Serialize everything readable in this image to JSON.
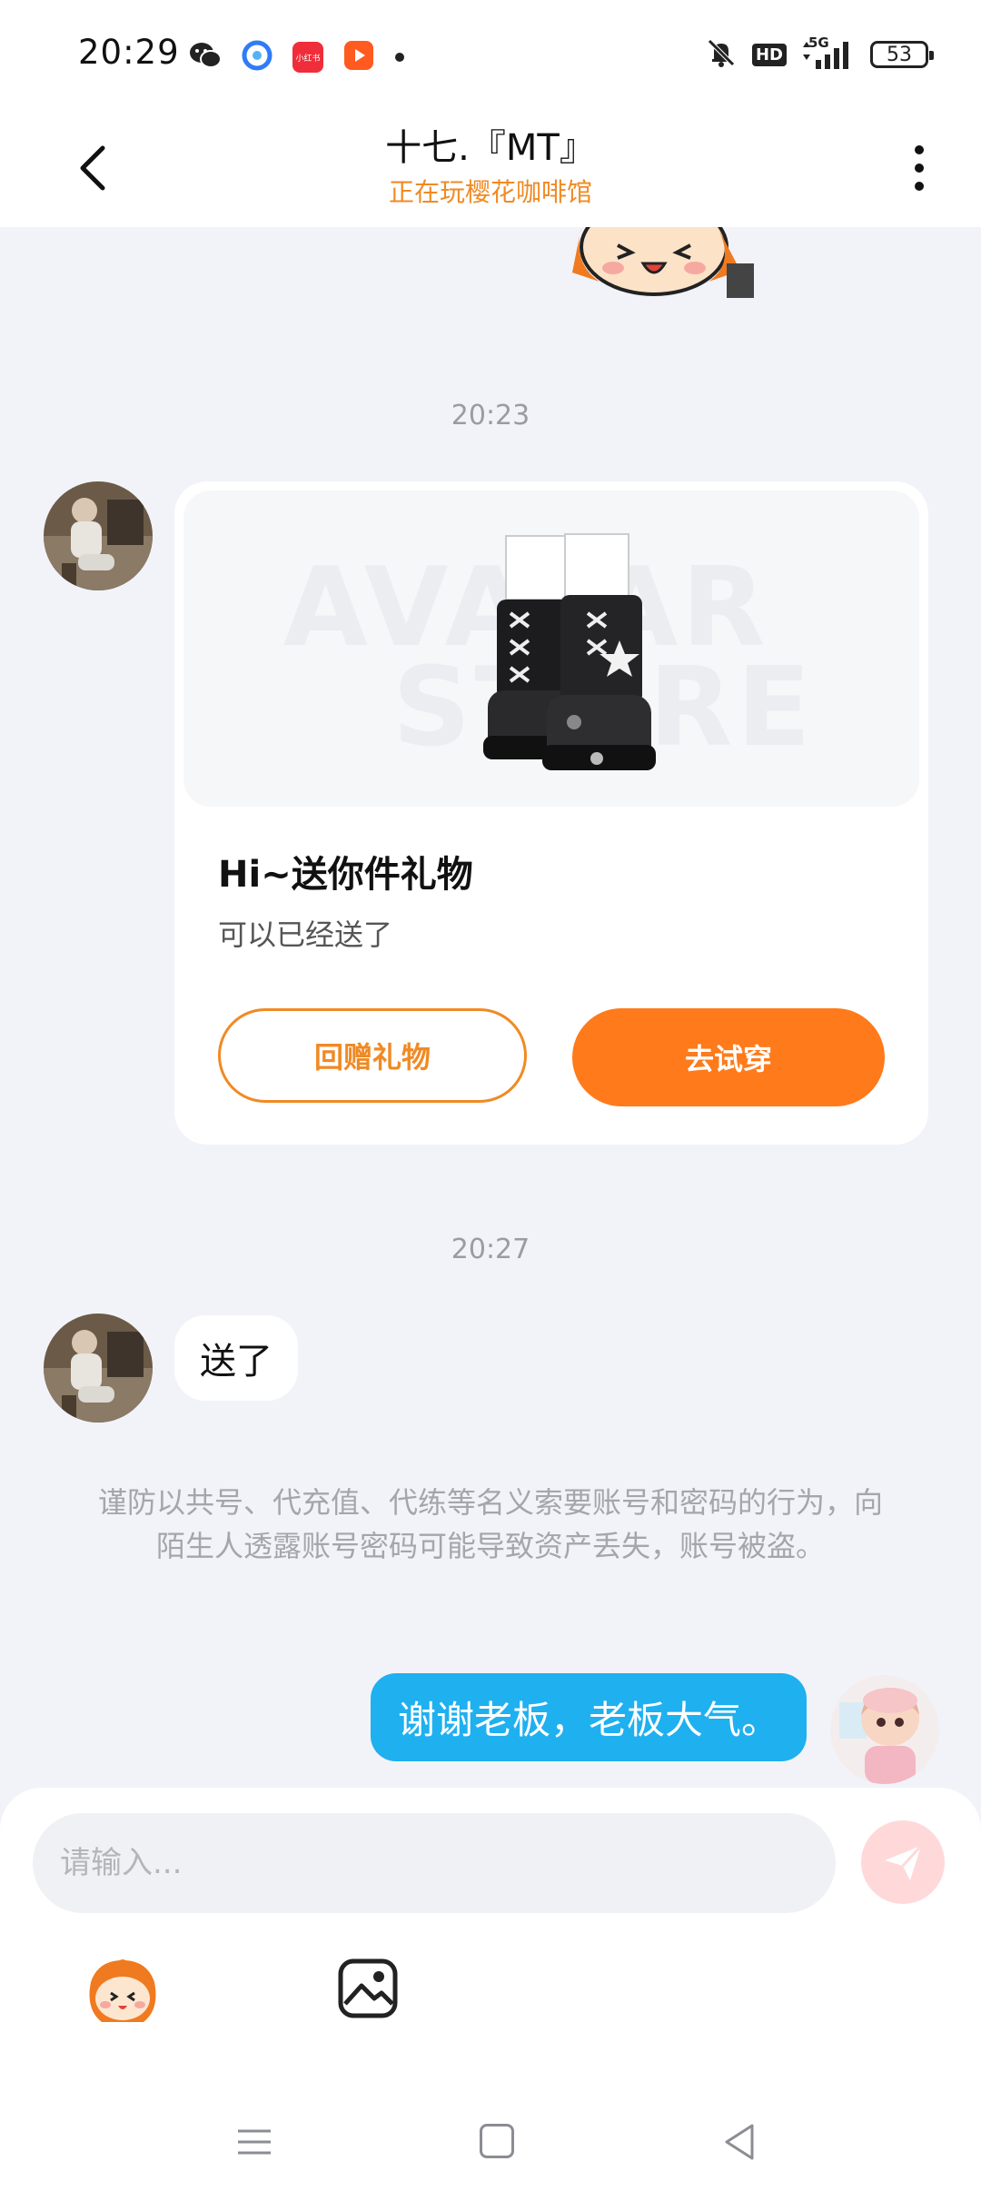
{
  "status_bar": {
    "time": "20:29",
    "network": "5G",
    "hd_label": "HD",
    "battery": "53",
    "notification_icons": [
      "wechat-icon",
      "browser-icon",
      "xiaohongshu-icon",
      "video-icon",
      "dot-icon"
    ],
    "xiaohongshu_label": "小红书"
  },
  "header": {
    "title": "十七.『MT』",
    "subtitle": "正在玩樱花咖啡馆"
  },
  "chat": {
    "messages": [
      {
        "type": "timestamp",
        "text": "20:23"
      },
      {
        "type": "gift",
        "watermark_line1": "AVATAR",
        "watermark_line2": "STORE",
        "title": "Hi~送你件礼物",
        "desc": "可以已经送了",
        "return_label": "回赠礼物",
        "try_label": "去试穿"
      },
      {
        "type": "timestamp",
        "text": "20:27"
      },
      {
        "type": "text",
        "side": "left",
        "text": "送了"
      },
      {
        "type": "notice",
        "text": "谨防以共号、代充值、代练等名义索要账号和密码的行为，向陌生人透露账号密码可能导致资产丢失，账号被盗。"
      },
      {
        "type": "text",
        "side": "right",
        "text": "谢谢老板，老板大气。"
      }
    ]
  },
  "input": {
    "placeholder": "请输入..."
  },
  "colors": {
    "accent_orange": "#FF7A1A",
    "subtitle_orange": "#F08A24",
    "right_bubble": "#1FB0F0",
    "send_button": "#FFD9D9"
  }
}
